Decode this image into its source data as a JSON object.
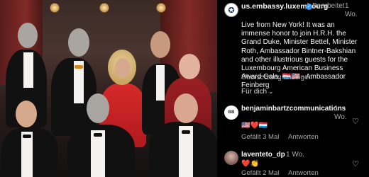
{
  "post": {
    "account_name": "us.embassy.luxembourg",
    "edited_label": "Bearbeitet",
    "time": "1 Wo.",
    "caption": "Live from New York! It was an immense honor to join H.R.H. the Grand Duke, Minister Bettel, Minister Roth, Ambassador Bintner-Bakshian and other illustrious guests for the Luxembourg American Business Award Gala. 🇱🇺🇺🇸 - Ambassador Feinberg",
    "translate_label": "Übersetzung anzeigen",
    "more_label": "Für dich"
  },
  "comments": [
    {
      "username": "benjaminbartzcommunications",
      "time": "1 Wo.",
      "body": "🇺🇸❤️🇱🇺",
      "likes": "3 Mal",
      "likes_prefix": "Gefällt",
      "reply_label": "Antworten",
      "avatar_text": "BB"
    },
    {
      "username": "laventeto_dp",
      "time": "1 Wo.",
      "body": "❤️👏",
      "likes": "2 Mal",
      "likes_prefix": "Gefällt",
      "reply_label": "Antworten"
    }
  ],
  "icons": {
    "verified": "verified-badge-icon",
    "heart": "heart-outline-icon",
    "chevron": "chevron-down-icon",
    "seal": "embassy-seal-icon"
  },
  "colors": {
    "background": "#000000",
    "text": "#f5f5f5",
    "muted": "#a8a8a8",
    "verified": "#3897f0"
  }
}
